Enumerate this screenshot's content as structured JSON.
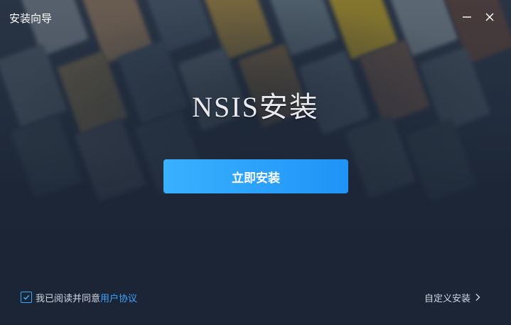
{
  "window": {
    "title": "安装向导"
  },
  "main": {
    "heading": "NSIS安装",
    "install_button_label": "立即安装"
  },
  "footer": {
    "agree_checked": true,
    "agree_text": "我已阅读并同意",
    "agree_link": "用户协议",
    "custom_install_label": "自定义安装"
  },
  "icons": {
    "minimize": "minimize-icon",
    "close": "close-icon",
    "checkbox": "checkmark-icon",
    "custom_arrow": "chevron-right-icon"
  },
  "colors": {
    "background": "#1b2535",
    "accent": "#3aa6ff",
    "button_start": "#3ab1ff",
    "button_end": "#1f93f7"
  }
}
